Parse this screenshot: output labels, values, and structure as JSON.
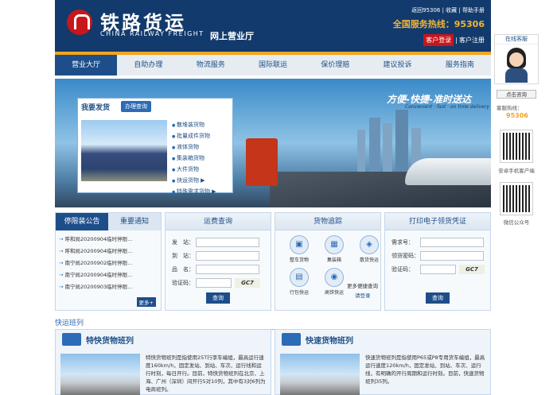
{
  "header": {
    "logo_cn": "铁路货运",
    "logo_en": "CHINA RAILWAY FREIGHT",
    "subtitle": "网上营业厅",
    "top_links": "返回95306 | 收藏 | 帮助手册",
    "hotline": "全国服务热线：95306",
    "login_btn": "客户登录",
    "register_btn": "客户注册"
  },
  "nav": [
    "营业大厅",
    "自助办理",
    "物流服务",
    "国际联运",
    "保价理赔",
    "建议投诉",
    "服务指南"
  ],
  "banner": {
    "slogan": "方便-快捷-准时送达",
    "slogan_en": "Convenient · fast · on time delivery",
    "ship_title": "我要发货",
    "ship_btn": "办理查询",
    "ship_items": [
      "散堆装货物",
      "批量成件货物",
      "液体货物",
      "集装箱货物",
      "大件货物",
      "快运货物 ▶",
      "特殊需求货物 ▶"
    ]
  },
  "notice": {
    "tab1": "停限装公告",
    "tab2": "重要通知",
    "items": [
      "呼和局20200904临时停限...",
      "呼和局20200904临时停限...",
      "南宁局20200902临时停限...",
      "南宁局20200904临时停限...",
      "南宁局20200903临时停限..."
    ],
    "more": "更多+"
  },
  "freight_query": {
    "title": "运费查询",
    "from": "发　站：",
    "to": "到　站：",
    "goods": "品　名：",
    "captcha": "验证码：",
    "captcha_img": "GC7",
    "btn": "查询"
  },
  "tracking": {
    "title": "货物追踪",
    "services": [
      "整车货物",
      "集装箱",
      "散货快运",
      "行包快运",
      "高铁快运"
    ],
    "more": "更多便捷查询",
    "login": "请登录"
  },
  "voucher": {
    "title": "打印电子领货凭证",
    "order": "需求号：",
    "code": "领货密码：",
    "captcha": "验证码：",
    "captcha_img": "GC7",
    "btn": "查询"
  },
  "section": {
    "title": "快运班列",
    "card1_title": "特快货物班列",
    "card1_text": "特快货物班列是指使用25T行李车编组，最高运行速度160km/h，固定发站、到站、车次、运行线和运行时刻，每日开行。目前，特快货物班列在北京、上海、广州（深圳）间开行5对10列，其中有3对6列为电商班列。",
    "card2_title": "快速货物班列",
    "card2_text": "快速货物班列是指使用P65或P8专用货车编组，最高运行速度120km/h，固定发站、到站、车次、运行线，有明确的开行周期和运行时刻。目前，快速货物班列35列。"
  },
  "sidebar": {
    "kefu_title": "在线客服",
    "consult": "点击咨询",
    "tel_label": "客服热线：",
    "tel": "95306",
    "qr1_label": "安卓手机客户端",
    "qr2_label": "微信公众号"
  },
  "colors": {
    "navy": "#123a6c",
    "orange": "#f1a41f",
    "red": "#c8161d",
    "blue": "#1d4e8a"
  }
}
